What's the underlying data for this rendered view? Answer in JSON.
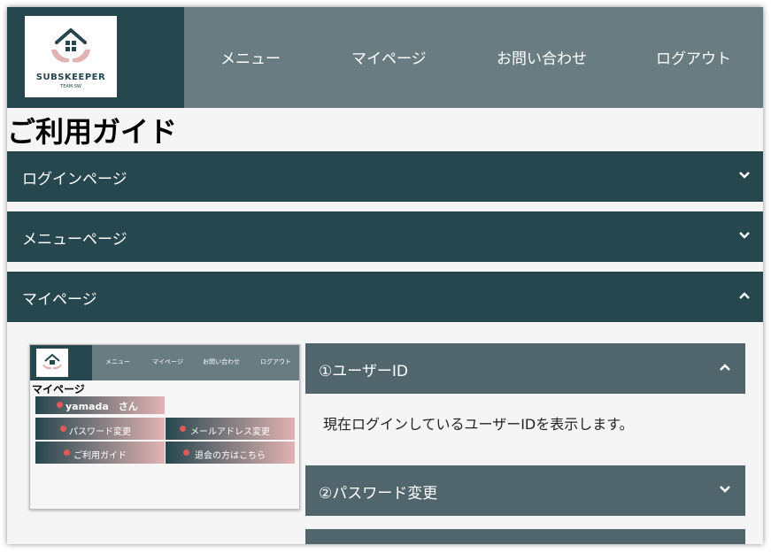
{
  "header": {
    "logo_text": "SUBSKEEPER",
    "logo_sub": "TEAM SW",
    "nav": [
      "メニュー",
      "マイページ",
      "お問い合わせ",
      "ログアウト"
    ]
  },
  "page_title": "ご利用ガイド",
  "accordion": [
    {
      "label": "ログインページ",
      "state": "collapsed"
    },
    {
      "label": "メニューページ",
      "state": "collapsed"
    },
    {
      "label": "マイページ",
      "state": "expanded"
    }
  ],
  "preview": {
    "nav": [
      "メニュー",
      "マイページ",
      "お問い合わせ",
      "ログアウト"
    ],
    "title": "マイページ",
    "user": "yamada　さん",
    "buttons": [
      "パスワード変更",
      "メールアドレス変更",
      "ご利用ガイド",
      "退会の方はこちら"
    ]
  },
  "sub_sections": [
    {
      "label": "①ユーザーID",
      "state": "expanded",
      "body": "現在ログインしているユーザーIDを表示します。"
    },
    {
      "label": "②パスワード変更",
      "state": "collapsed"
    }
  ],
  "colors": {
    "dark_teal": "#26474e",
    "slate": "#687c82",
    "sub_header": "#51666c",
    "accent_pink": "#e2b3b3"
  }
}
